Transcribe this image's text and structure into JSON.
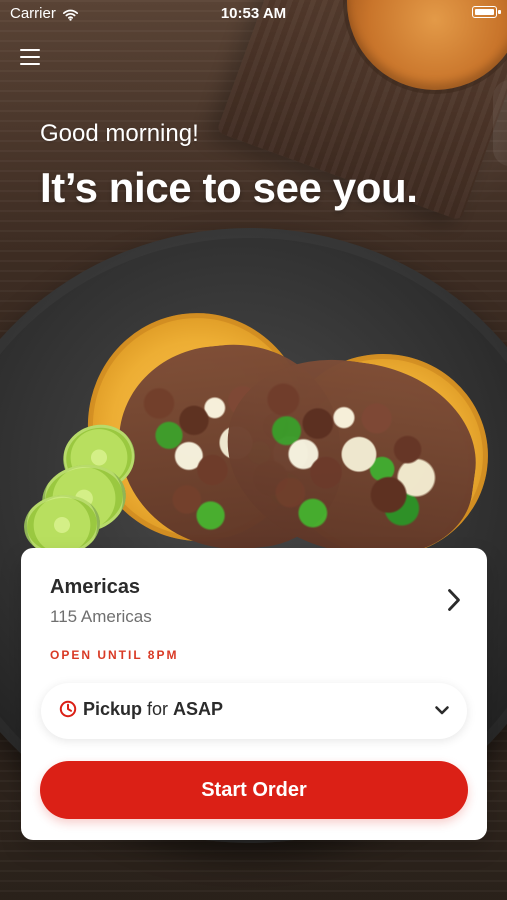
{
  "status_bar": {
    "carrier": "Carrier",
    "time": "10:53 AM",
    "icons": {
      "wifi": "wifi-icon",
      "battery": "battery-icon"
    }
  },
  "header": {
    "menu_icon": "menu-icon",
    "greeting": "Good morning!",
    "headline": "It’s nice to see you."
  },
  "location_card": {
    "title": "Americas",
    "subtitle": "115 Americas",
    "status": "OPEN UNTIL 8PM",
    "chevron_icon": "chevron-right-icon",
    "pickup": {
      "clock_icon": "clock-icon",
      "method": "Pickup",
      "joiner": "for",
      "time": "ASAP",
      "dropdown_icon": "chevron-down-icon"
    },
    "button_label": "Start Order"
  },
  "colors": {
    "accent_red": "#db2016",
    "status_red": "#d93a25",
    "text_dark": "#2b2b2b",
    "text_muted": "#6f6f6f",
    "card_bg": "#ffffff"
  }
}
